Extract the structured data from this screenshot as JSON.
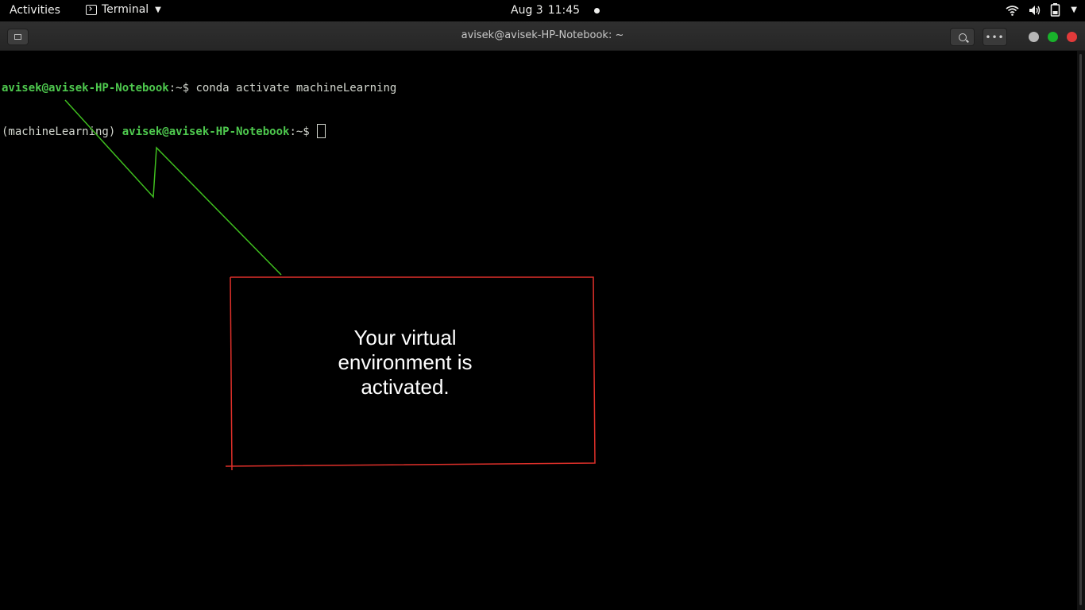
{
  "topbar": {
    "activities": "Activities",
    "app_name": "Terminal",
    "date": "Aug 3",
    "time": "11:45"
  },
  "window": {
    "title": "avisek@avisek-HP-Notebook: ~",
    "accent": {
      "close": "#e23a3a",
      "maximize": "#19b22b",
      "minimize": "#b7b7b7"
    }
  },
  "terminal": {
    "line1": {
      "user_host": "avisek@avisek-HP-Notebook",
      "cwd": ":~",
      "prompt": "$ ",
      "command": "conda activate machineLearning"
    },
    "line2": {
      "env": "(machineLearning) ",
      "user_host": "avisek@avisek-HP-Notebook",
      "cwd": ":~",
      "prompt": "$ "
    },
    "colors": {
      "prompt": "#4ec94e",
      "text": "#d3d7cf",
      "background": "#000000"
    }
  },
  "annotation": {
    "lines": [
      "Your virtual",
      "environment is",
      "activated."
    ],
    "border_color": "#e0302a",
    "arrow_color": "#3fbf1f"
  }
}
